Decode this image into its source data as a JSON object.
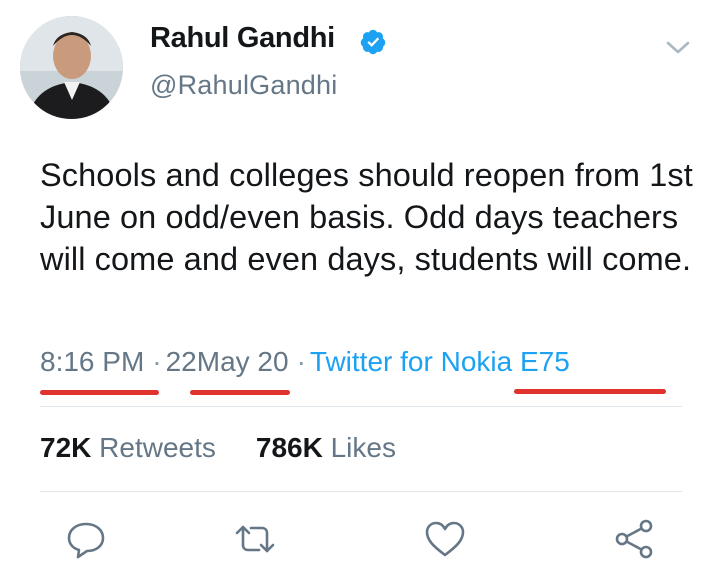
{
  "author": {
    "name": "Rahul Gandhi",
    "handle": "@RahulGandhi",
    "verified": true
  },
  "tweet": {
    "text": "Schools and colleges should reopen from 1st June on odd/even basis. Odd days teachers will come and even days, students will come."
  },
  "meta": {
    "time": "8:16 PM",
    "separator": "·",
    "date": "22May 20",
    "source": "Twitter for Nokia E75"
  },
  "stats": {
    "retweets_count": "72K",
    "retweets_label": "Retweets",
    "likes_count": "786K",
    "likes_label": "Likes"
  },
  "colors": {
    "link": "#1da1f2",
    "muted": "#657786",
    "underline_annotation": "#e0332e",
    "verified_badge": "#1da1f2"
  },
  "icons": [
    "verified-icon",
    "chevron-down-icon",
    "reply-icon",
    "retweet-icon",
    "like-icon",
    "share-icon"
  ]
}
